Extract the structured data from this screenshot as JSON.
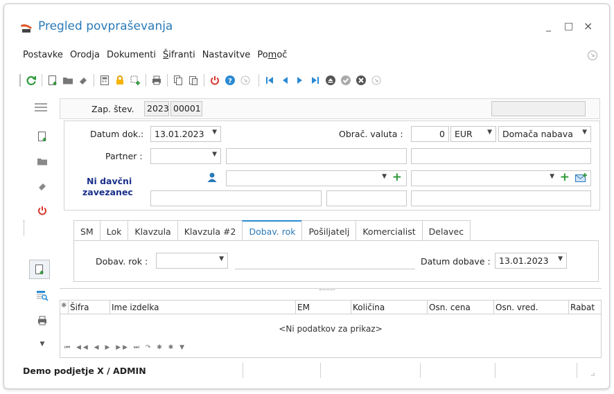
{
  "window": {
    "title": "Pregled povpraševanja",
    "controls": {
      "minimize": "_",
      "maximize": "□",
      "close": "×"
    }
  },
  "menu": {
    "items": [
      {
        "label": "Postavke"
      },
      {
        "label": "Orodja"
      },
      {
        "label": "Dokumenti"
      },
      {
        "label_ul": "Š",
        "label_rest": "ifranti"
      },
      {
        "label": "Nastavitve"
      },
      {
        "label_pre": "Po",
        "label_ul": "m",
        "label_rest": "oč"
      }
    ]
  },
  "toolbar": {
    "icons": [
      "refresh-icon",
      "new-document-icon",
      "open-folder-icon",
      "eraser-icon",
      "calculator-icon",
      "lock-icon",
      "grid-add-icon",
      "print-icon",
      "copy-icon",
      "paste-icon",
      "power-icon",
      "help-icon",
      "circle-arrow-icon",
      "first-record-icon",
      "prev-record-icon",
      "next-record-icon",
      "last-record-icon",
      "eject-icon",
      "confirm-icon",
      "cancel-icon",
      "circle-arrow-right-icon"
    ]
  },
  "header": {
    "doc_number_label": "Zap. štev.",
    "year": "2023",
    "number": "00001"
  },
  "form": {
    "date_label": "Datum dok.:",
    "date_value": "13.01.2023",
    "currency_label": "Obrač. valuta :",
    "currency_amount": "0",
    "currency_code": "EUR",
    "procurement_type": "Domača nabava",
    "partner_label": "Partner :",
    "tax_status_line1": "Ni davčni",
    "tax_status_line2": "zavezanec"
  },
  "tabs": [
    {
      "label": "SM"
    },
    {
      "label": "Lok"
    },
    {
      "label": "Klavzula"
    },
    {
      "label": "Klavzula #2"
    },
    {
      "label": "Dobav. rok",
      "active": true
    },
    {
      "label": "Pošiljatelj"
    },
    {
      "label": "Komercialist"
    },
    {
      "label": "Delavec"
    }
  ],
  "tab_content": {
    "delivery_term_label": "Dobav. rok :",
    "delivery_date_label": "Datum dobave :",
    "delivery_date_value": "13.01.2023"
  },
  "grid": {
    "columns": [
      "Šifra",
      "Ime izdelka",
      "EM",
      "Količina",
      "Osn. cena",
      "Osn. vred.",
      "Rabat"
    ],
    "empty_text": "<Ni podatkov za prikaz>",
    "nav": "⏮ ◀◀ ◀ ▶ ▶▶ ⏭ ↷ ✱ ✱ ▼"
  },
  "status": {
    "text": "Demo podjetje X / ADMIN"
  },
  "colors": {
    "accent": "#2a7ab8",
    "green": "#2e9a3a",
    "red": "#d9342b",
    "nav_blue": "#2a8ad4"
  }
}
